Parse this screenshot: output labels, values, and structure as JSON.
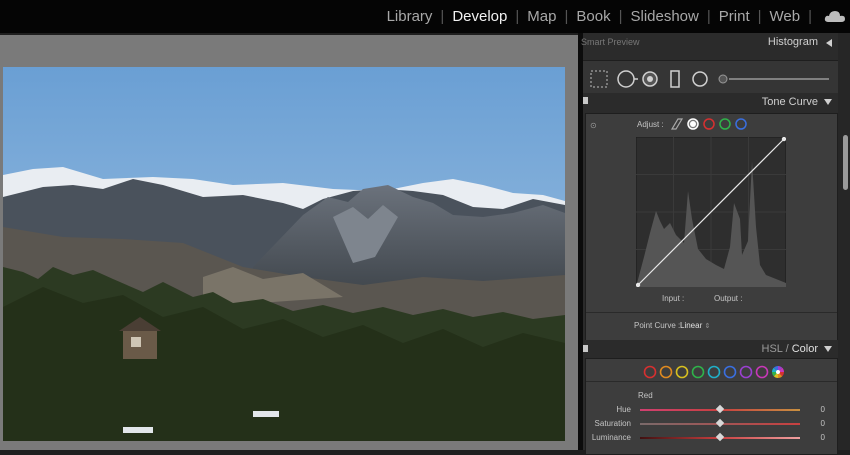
{
  "topbar": {
    "modules": [
      "Library",
      "Develop",
      "Map",
      "Book",
      "Slideshow",
      "Print",
      "Web"
    ],
    "active_module": "Develop",
    "cloud_icon": "cloud-icon"
  },
  "panels": {
    "histogram": {
      "smart_preview": "Smart Preview",
      "title": "Histogram"
    },
    "tone_curve": {
      "title": "Tone Curve",
      "adjust_label": "Adjust :",
      "input_label": "Input :",
      "output_label": "Output :",
      "point_curve_label": "Point Curve :",
      "point_curve_value": "Linear",
      "channel_colors": [
        "#aaaaaa",
        "#ffffff",
        "#d73030",
        "#2fb34a",
        "#3a6fe0"
      ]
    },
    "hsl": {
      "title_hsl": "HSL",
      "title_sep": " / ",
      "title_color": "Color",
      "swatch_colors": [
        "#d73030",
        "#e08a20",
        "#d8c020",
        "#2fb34a",
        "#20b0c8",
        "#3a6fe0",
        "#9a40d0",
        "#c838b8"
      ],
      "channel": "Red",
      "sliders": [
        {
          "label": "Hue",
          "value": "0"
        },
        {
          "label": "Saturation",
          "value": "0"
        },
        {
          "label": "Luminance",
          "value": "0"
        }
      ]
    }
  }
}
